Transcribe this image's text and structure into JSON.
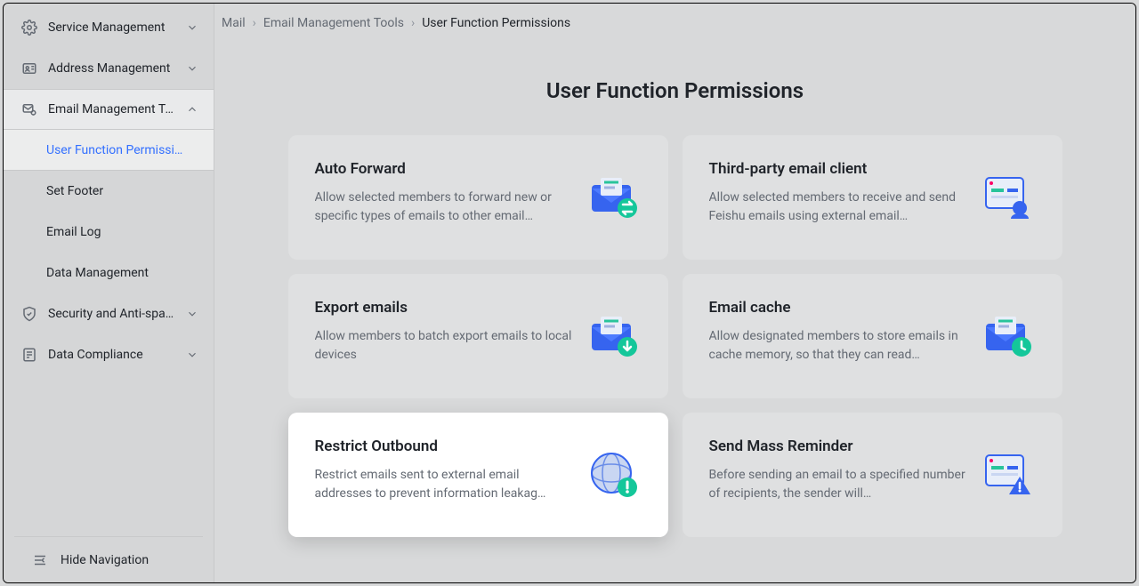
{
  "sidebar": {
    "groups": [
      {
        "label": "Service Management",
        "expanded": false
      },
      {
        "label": "Address Management",
        "expanded": false
      },
      {
        "label": "Email Management To…",
        "expanded": true,
        "children": [
          {
            "label": "User Function Permissi…",
            "selected": true
          },
          {
            "label": "Set Footer"
          },
          {
            "label": "Email Log"
          },
          {
            "label": "Data Management"
          }
        ]
      },
      {
        "label": "Security and Anti-spam",
        "expanded": false
      },
      {
        "label": "Data Compliance",
        "expanded": false
      }
    ],
    "footer": "Hide Navigation"
  },
  "breadcrumbs": {
    "items": [
      "Mail",
      "Email Management Tools",
      "User Function Permissions"
    ]
  },
  "page": {
    "title": "User Function Permissions",
    "cards": [
      {
        "title": "Auto Forward",
        "desc": "Allow selected members to forward new or specific types of emails to other email…",
        "icon": "envelope-swap"
      },
      {
        "title": "Third-party email client",
        "desc": "Allow selected members to receive and send Feishu emails using external email…",
        "icon": "window-user"
      },
      {
        "title": "Export emails",
        "desc": "Allow members to batch export emails to local devices",
        "icon": "envelope-down"
      },
      {
        "title": "Email cache",
        "desc": "Allow designated members to store emails in cache memory, so that they can read…",
        "icon": "envelope-clock"
      },
      {
        "title": "Restrict Outbound",
        "desc": "Restrict emails sent to external email addresses to prevent information leakag…",
        "icon": "globe-alert",
        "active": true
      },
      {
        "title": "Send Mass Reminder",
        "desc": "Before sending an email to a specified number of recipients, the sender will…",
        "icon": "window-warn"
      }
    ]
  }
}
